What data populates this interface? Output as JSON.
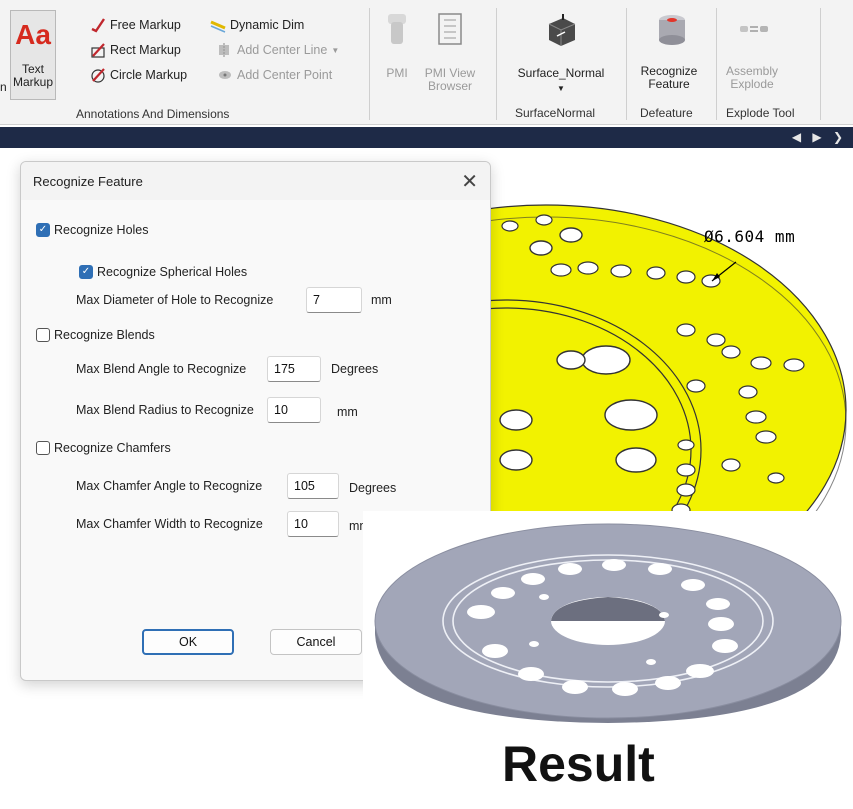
{
  "ribbon": {
    "annotations": {
      "text_markup_label": "Text Markup",
      "aa_glyph": "Aa",
      "cut_label": "n",
      "free_markup": "Free Markup",
      "rect_markup": "Rect Markup",
      "circle_markup": "Circle Markup",
      "dynamic_dim": "Dynamic Dim",
      "add_center_line": "Add Center Line",
      "add_center_point": "Add Center Point",
      "group_label": "Annotations And Dimensions"
    },
    "pmi": {
      "pmi_label": "PMI",
      "pmi_view_browser_label": "PMI View Browser"
    },
    "surface_normal": {
      "button_label": "Surface_Normal",
      "group_label": "SurfaceNormal"
    },
    "defeature": {
      "button_label": "Recognize Feature",
      "group_label": "Defeature"
    },
    "explode": {
      "button_label": "Assembly Explode",
      "group_label": "Explode Tool"
    }
  },
  "darkbar": {
    "arrows": "◀ ▶ ❯"
  },
  "annotation": {
    "dimension_text": "Ø6.604 mm"
  },
  "dialog": {
    "title": "Recognize Feature",
    "close_glyph": "✕",
    "recognize_holes": {
      "label": "Recognize Holes",
      "checked": true
    },
    "recognize_spherical_holes": {
      "label": "Recognize Spherical Holes",
      "checked": true
    },
    "max_hole_diameter": {
      "label": "Max Diameter of Hole to Recognize",
      "value": "7",
      "unit": "mm"
    },
    "recognize_blends": {
      "label": "Recognize Blends",
      "checked": false
    },
    "max_blend_angle": {
      "label": "Max Blend Angle to Recognize",
      "value": "175",
      "unit": "Degrees"
    },
    "max_blend_radius": {
      "label": "Max Blend Radius to Recognize",
      "value": "10",
      "unit": "mm"
    },
    "recognize_chamfers": {
      "label": "Recognize Chamfers",
      "checked": false
    },
    "max_chamfer_angle": {
      "label": "Max Chamfer Angle to Recognize",
      "value": "105",
      "unit": "Degrees"
    },
    "max_chamfer_width": {
      "label": "Max Chamfer Width to Recognize",
      "value": "10",
      "unit": "mm"
    },
    "ok_label": "OK",
    "cancel_label": "Cancel"
  },
  "result": {
    "caption": "Result"
  },
  "colors": {
    "ribbon_bg": "#f3f3f3",
    "dark_bar": "#1e2a47",
    "disc_yellow": "#f2f200",
    "disc_grey": "#9ea2b3",
    "checkbox_blue": "#2f6fb5",
    "aa_red": "#d62a1e"
  }
}
